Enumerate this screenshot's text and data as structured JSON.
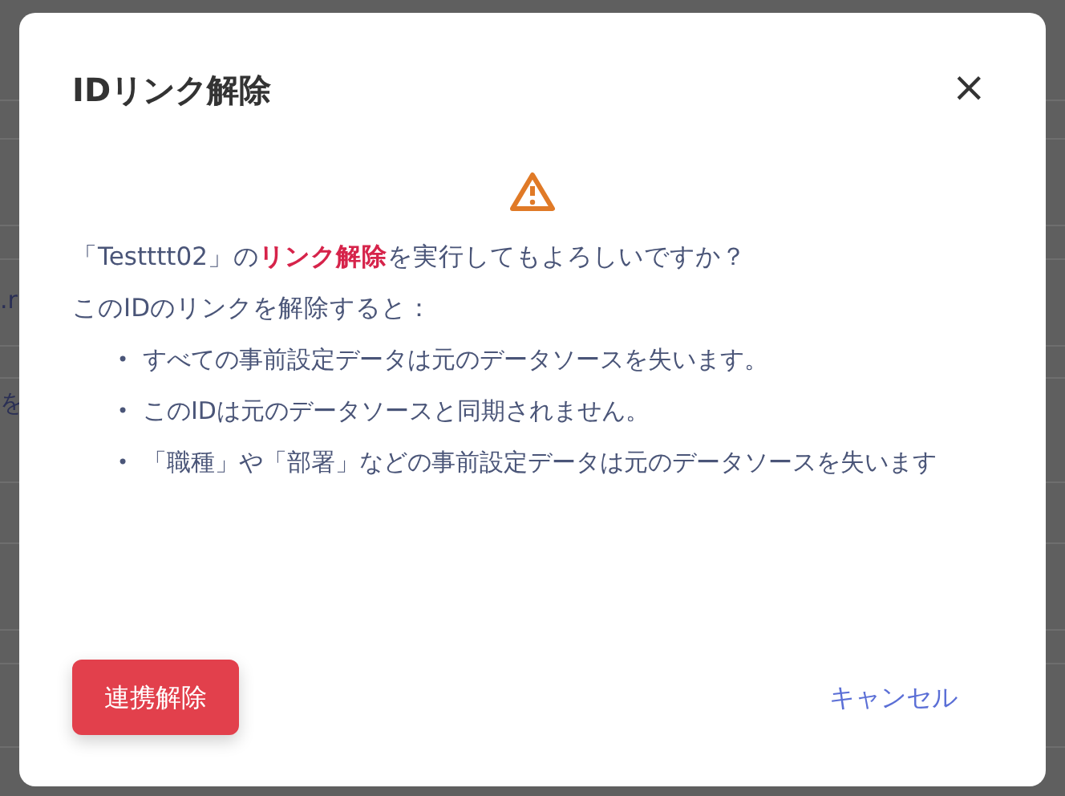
{
  "background": {
    "fragments": [
      ".r",
      "を"
    ]
  },
  "dialog": {
    "title": "IDリンク解除",
    "close": "×",
    "question": "「Testttt02」の**リンク解除**を実行してもよろしいですか？",
    "intro": "このIDのリンクを解除すると：",
    "points": [
      {
        "marker": "•",
        "text": "すべての事前設定データは元のデータソースを失います。"
      },
      {
        "marker": "•",
        "text": "このIDは元のデータソースと同期されません。"
      },
      {
        "marker": "•",
        "text": "「職種」や「部署」などの事前設定データは元のデータソースを失います"
      }
    ],
    "buttons": [
      {
        "kind": "primary",
        "label": "連携解除"
      },
      {
        "kind": "link",
        "label": "キャンセル"
      }
    ]
  }
}
